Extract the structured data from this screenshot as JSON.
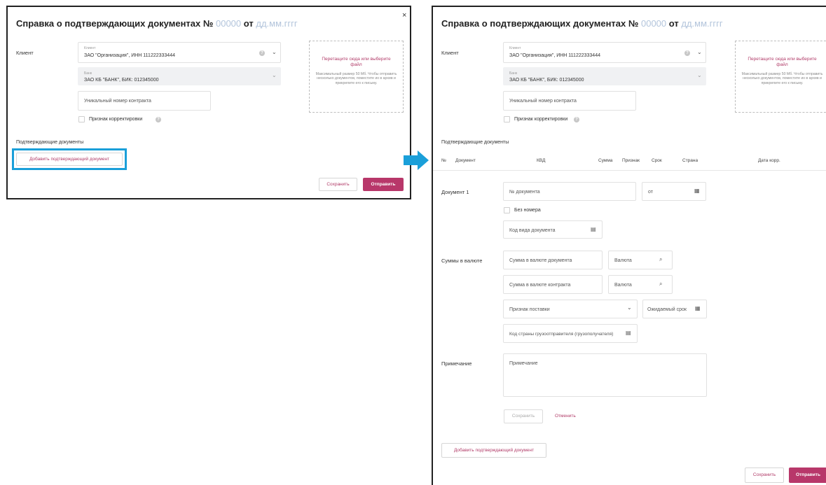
{
  "left_panel": {
    "title_main": "Справка о подтверждающих документах №",
    "number_placeholder": "00000",
    "from_word": "от",
    "date_placeholder": "дд.мм.гггг",
    "close_label": "×",
    "client_label": "Клиент",
    "client_field": {
      "small_label": "Клиент",
      "value": "ЗАО \"Организация\", ИНН 111222333444"
    },
    "bank_field": {
      "small_label": "Банк",
      "value": "ЗАО КБ \"БАНК\", БИК: 012345000"
    },
    "contract_placeholder": "Уникальный номер контракта",
    "correction_label": "Признак корректировки",
    "dropzone": {
      "title": "Перетащите сюда или выберите файл",
      "hint": "Максимальный размер 50 Мб. Чтобы отправить несколько документов, поместите их в архив и прикрепите его к письму."
    },
    "docs_section_label": "Подтверждающие документы",
    "add_doc_button": "Добавить подтверждающий документ",
    "save_button": "Сохранить",
    "send_button": "Отправить"
  },
  "right_panel": {
    "title_main": "Справка о подтверждающих документах №",
    "number_placeholder": "00000",
    "from_word": "от",
    "date_placeholder": "дд.мм.гггг",
    "client_label": "Клиент",
    "client_field": {
      "small_label": "Клиент",
      "value": "ЗАО \"Организация\", ИНН 111222333444"
    },
    "bank_field": {
      "small_label": "Банк",
      "value": "ЗАО КБ \"БАНК\", БИК: 012345000"
    },
    "contract_placeholder": "Уникальный номер контракта",
    "correction_label": "Признак корректировки",
    "dropzone": {
      "title": "Перетащите сюда или выберите файл",
      "hint": "Максимальный размер 50 Мб. Чтобы отправить несколько документов, поместите их в архив и прикрепите его к письму."
    },
    "docs_section_label": "Подтверждающие документы",
    "table_headers": {
      "num": "№",
      "doc": "Документ",
      "kvd": "КВД",
      "sum": "Сумма",
      "sign": "Признак",
      "term": "Срок",
      "country": "Страна",
      "corr_date": "Дата корр."
    },
    "document_label": "Документ 1",
    "doc_number_placeholder": "№ документа",
    "doc_date_placeholder": "от",
    "no_number_label": "Без номера",
    "doc_kind_placeholder": "Код вида документа",
    "amounts_label": "Суммы в валюте",
    "amount_doc_placeholder": "Сумма в валюте документа",
    "currency_placeholder_1": "Валюта",
    "amount_contract_placeholder": "Сумма в валюте контракта",
    "currency_placeholder_2": "Валюта",
    "delivery_sign_placeholder": "Признак поставки",
    "expected_term_placeholder": "Ожидаемый срок",
    "shipper_country_placeholder": "Код страны грузоотправителя (грузополучателя)",
    "note_label": "Примечание",
    "note_placeholder": "Примечание",
    "inner_save_button": "Сохранить",
    "cancel_link": "Отменить",
    "add_doc_button": "Добавить подтверждающий документ",
    "save_button": "Сохранить",
    "send_button": "Отправить"
  },
  "colors": {
    "accent": "#b8376a",
    "highlight": "#1a9fd9",
    "arrow": "#1a9fd9"
  }
}
